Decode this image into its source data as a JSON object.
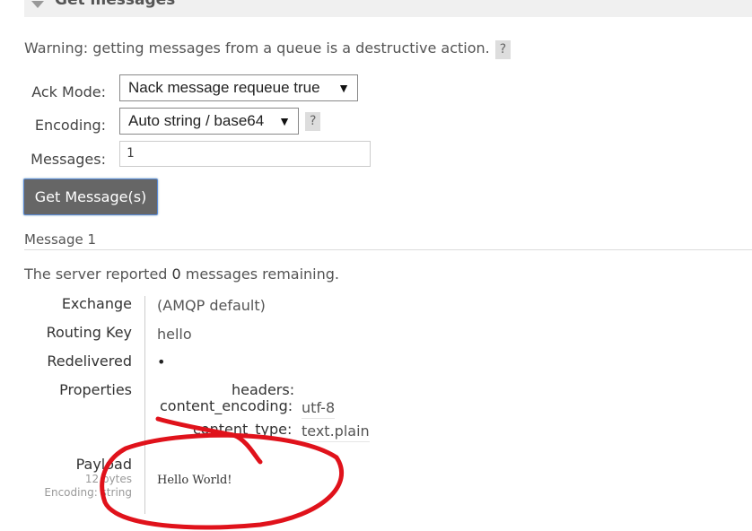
{
  "section": {
    "title": "Get messages"
  },
  "warning": {
    "text": "Warning: getting messages from a queue is a destructive action.",
    "help": "?"
  },
  "form": {
    "ack_mode_label": "Ack Mode:",
    "ack_mode_value": "Nack message requeue true",
    "encoding_label": "Encoding:",
    "encoding_value": "Auto string / base64",
    "encoding_help": "?",
    "messages_label": "Messages:",
    "messages_value": "1",
    "submit_label": "Get Message(s)"
  },
  "message": {
    "title": "Message 1",
    "server_prefix": "The server reported ",
    "remaining_count": "0",
    "server_suffix": " messages remaining.",
    "exchange_label": "Exchange",
    "exchange_value": "(AMQP default)",
    "routing_key_label": "Routing Key",
    "routing_key_value": "hello",
    "redelivered_label": "Redelivered",
    "redelivered_value": "•",
    "properties_label": "Properties",
    "properties": {
      "headers_key": "headers:",
      "content_encoding_key": "content_encoding:",
      "content_encoding_value": "utf-8",
      "content_type_key": "content_type:",
      "content_type_value": "text.plain"
    },
    "payload_label": "Payload",
    "payload_bytes": "12 bytes",
    "payload_encoding": "Encoding: string",
    "payload_text": "Hello World!"
  },
  "colors": {
    "annotation": "#e0121b",
    "button_bg": "#666666"
  }
}
